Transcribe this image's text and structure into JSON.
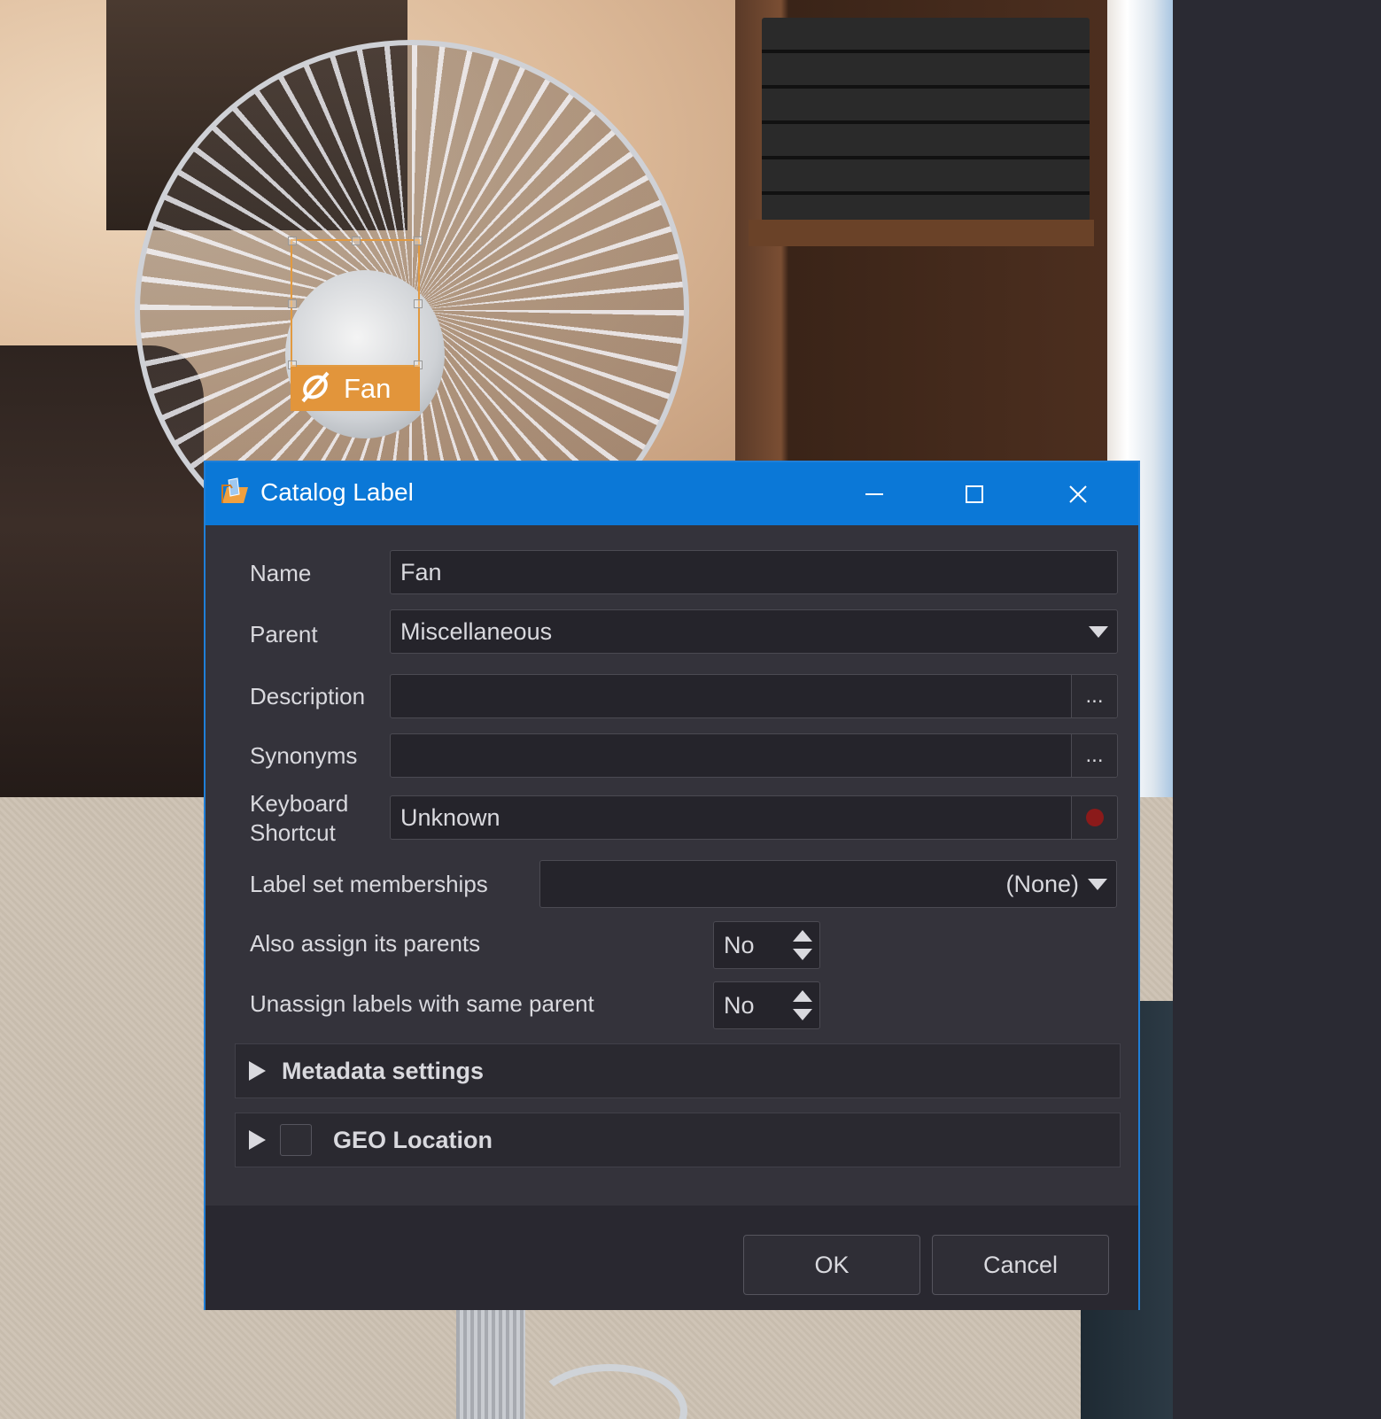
{
  "image_label": {
    "text": "Fan",
    "color": "#e2953b"
  },
  "dialog": {
    "title": "Catalog Label",
    "titlebar_color": "#0b78d7",
    "window_controls": [
      "minimize-icon",
      "maximize-icon",
      "close-icon"
    ],
    "fields": {
      "name": {
        "label": "Name",
        "value": "Fan"
      },
      "parent": {
        "label": "Parent",
        "value": "Miscellaneous"
      },
      "description": {
        "label": "Description",
        "value": "",
        "button": "..."
      },
      "synonyms": {
        "label": "Synonyms",
        "value": "",
        "button": "..."
      },
      "shortcut": {
        "label_line1": "Keyboard",
        "label_line2": "Shortcut",
        "value": "Unknown",
        "record_color": "#8b1a1a"
      },
      "label_sets": {
        "label": "Label set memberships",
        "value": "(None)"
      },
      "assign_parents": {
        "label": "Also assign its parents",
        "value": "No"
      },
      "unassign_same_parent": {
        "label": "Unassign labels with same parent",
        "value": "No"
      }
    },
    "sections": {
      "metadata": {
        "title": "Metadata settings"
      },
      "geo": {
        "title": "GEO Location",
        "checked": false
      }
    },
    "buttons": {
      "ok": "OK",
      "cancel": "Cancel"
    }
  }
}
